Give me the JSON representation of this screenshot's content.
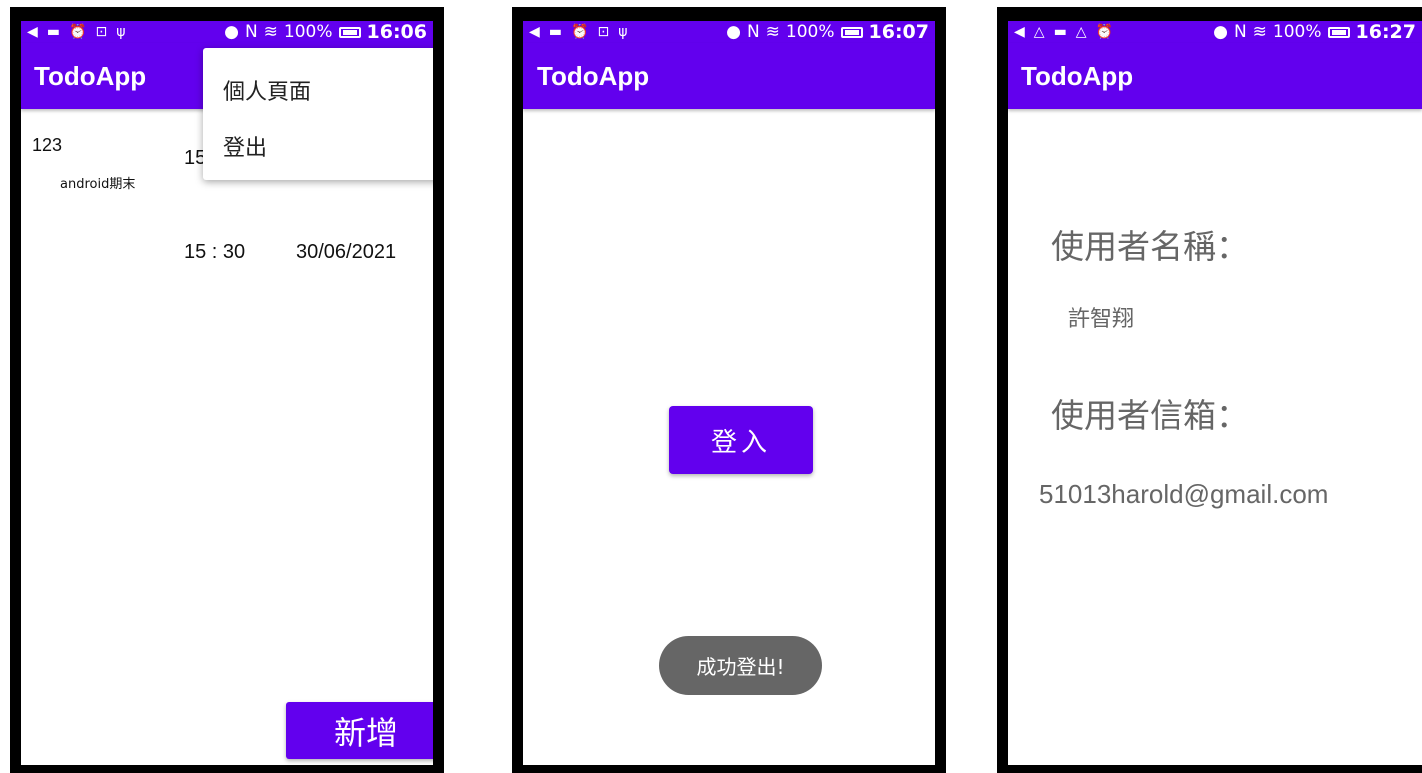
{
  "screens": [
    {
      "status": {
        "left_icons": [
          "back-arrow-icon",
          "image-icon",
          "alarm-icon",
          "code-icon",
          "usb-icon"
        ],
        "battery": "100%",
        "time": "16:06"
      },
      "app_title": "TodoApp",
      "todo_items": [
        {
          "title": "123",
          "subtitle": "android期末",
          "time": "15"
        },
        {
          "time": "15 : 30",
          "date": "30/06/2021"
        }
      ],
      "overflow_menu": [
        "個人頁面",
        "登出"
      ],
      "add_button": "新增"
    },
    {
      "status": {
        "left_icons": [
          "back-arrow-icon",
          "image-icon",
          "alarm-icon",
          "code-icon",
          "usb-icon"
        ],
        "battery": "100%",
        "time": "16:07"
      },
      "app_title": "TodoApp",
      "login_button": "登入",
      "toast": "成功登出!"
    },
    {
      "status": {
        "left_icons": [
          "back-arrow-icon",
          "drive-icon",
          "image-icon",
          "drive-icon",
          "alarm-icon"
        ],
        "battery": "100%",
        "time": "16:27"
      },
      "app_title": "TodoApp",
      "username_label": "使用者名稱：",
      "username": "許智翔",
      "email_label": "使用者信箱：",
      "email": "51013harold@gmail.com"
    }
  ],
  "colors": {
    "primary": "#6200ee",
    "toast": "#666666",
    "profile_text": "#666666"
  }
}
